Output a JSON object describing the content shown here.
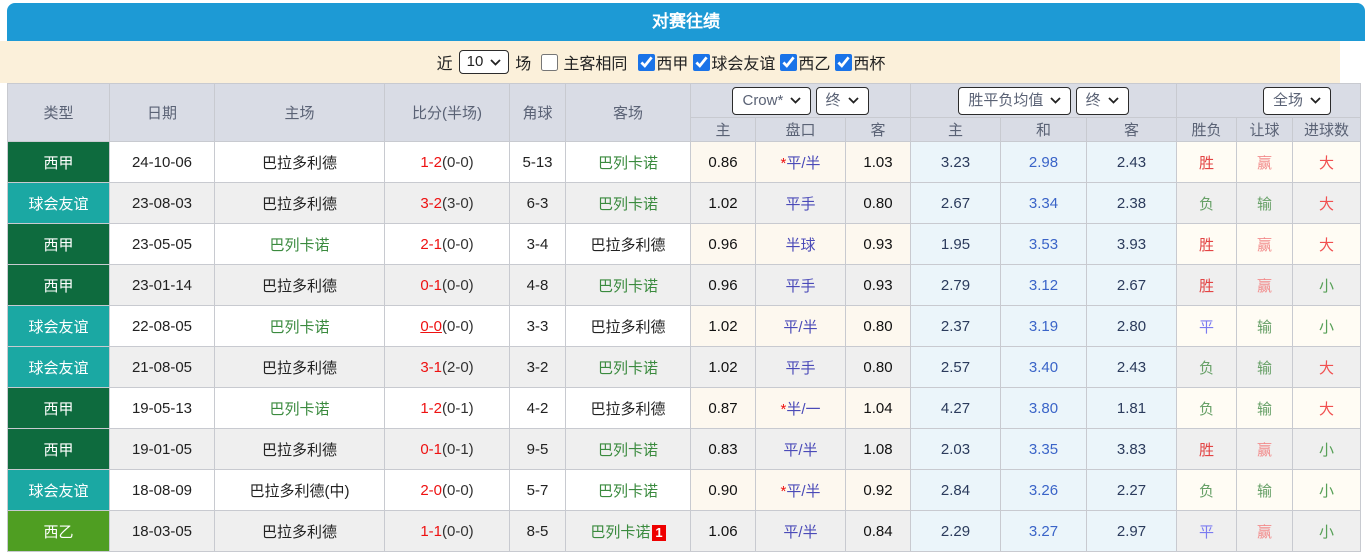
{
  "title": "对赛往绩",
  "colors": {
    "title_bar_blue": "#1d9ad5",
    "filter_bar_cream": "#fbf0da",
    "header_gray": "#d9dce5",
    "laliga_green": "#0e6b3e",
    "friendly_teal": "#1ba8a3",
    "segunda_green": "#4f9e22",
    "score_red": "#ee1111",
    "team_green": "#3a8a3e",
    "handicap_blue": "#4a4ab8",
    "avg_draw_blue": "#3a64c8",
    "avg_col_bg": "#ebf5fa",
    "win_red": "#e34444",
    "lose_green": "#67a067",
    "draw_blue": "#7b7bf0",
    "big_red": "#f15050",
    "small_green": "#57a057",
    "badge_red": "#ee0000",
    "checkbox_blue": "#1a73e8"
  },
  "filter": {
    "near_label": "近",
    "count_value": "10",
    "games_label": "场",
    "same_venue_label": "主客相同",
    "same_venue_checked": false,
    "leagues": [
      {
        "label": "西甲",
        "checked": true
      },
      {
        "label": "球会友谊",
        "checked": true
      },
      {
        "label": "西乙",
        "checked": true
      },
      {
        "label": "西杯",
        "checked": true
      }
    ]
  },
  "table": {
    "columns": [
      "类型",
      "日期",
      "主场",
      "比分(半场)",
      "角球",
      "客场"
    ],
    "odds_group": {
      "provider_select": "Crow*",
      "time_select": "终",
      "sub": [
        "主",
        "盘口",
        "客"
      ]
    },
    "avg_group": {
      "type_select": "胜平负均值",
      "time_select": "终",
      "sub": [
        "主",
        "和",
        "客"
      ]
    },
    "result_group": {
      "scope_select": "全场",
      "sub": [
        "胜负",
        "让球",
        "进球数"
      ]
    },
    "green_team": "巴列卡诺",
    "rows": [
      {
        "type": "西甲",
        "date": "24-10-06",
        "home": "巴拉多利德",
        "score": "1-2",
        "half": "(0-0)",
        "corner": "5-13",
        "away": "巴列卡诺",
        "odds": {
          "home": "0.86",
          "star": true,
          "handicap": "平/半",
          "away": "1.03"
        },
        "avg": {
          "home": "3.23",
          "draw": "2.98",
          "away": "2.43"
        },
        "result": {
          "outcome": "胜",
          "handicap": "赢",
          "goals": "大"
        }
      },
      {
        "type": "球会友谊",
        "date": "23-08-03",
        "home": "巴拉多利德",
        "score": "3-2",
        "half": "(3-0)",
        "corner": "6-3",
        "away": "巴列卡诺",
        "odds": {
          "home": "1.02",
          "star": false,
          "handicap": "平手",
          "away": "0.80"
        },
        "avg": {
          "home": "2.67",
          "draw": "3.34",
          "away": "2.38"
        },
        "result": {
          "outcome": "负",
          "handicap": "输",
          "goals": "大"
        }
      },
      {
        "type": "西甲",
        "date": "23-05-05",
        "home": "巴列卡诺",
        "score": "2-1",
        "half": "(0-0)",
        "corner": "3-4",
        "away": "巴拉多利德",
        "odds": {
          "home": "0.96",
          "star": false,
          "handicap": "半球",
          "away": "0.93"
        },
        "avg": {
          "home": "1.95",
          "draw": "3.53",
          "away": "3.93"
        },
        "result": {
          "outcome": "胜",
          "handicap": "赢",
          "goals": "大"
        }
      },
      {
        "type": "西甲",
        "date": "23-01-14",
        "home": "巴拉多利德",
        "score": "0-1",
        "half": "(0-0)",
        "corner": "4-8",
        "away": "巴列卡诺",
        "odds": {
          "home": "0.96",
          "star": false,
          "handicap": "平手",
          "away": "0.93"
        },
        "avg": {
          "home": "2.79",
          "draw": "3.12",
          "away": "2.67"
        },
        "result": {
          "outcome": "胜",
          "handicap": "赢",
          "goals": "小"
        }
      },
      {
        "type": "球会友谊",
        "date": "22-08-05",
        "home": "巴列卡诺",
        "score": "0-0",
        "score_underline": true,
        "half": "(0-0)",
        "corner": "3-3",
        "away": "巴拉多利德",
        "odds": {
          "home": "1.02",
          "star": false,
          "handicap": "平/半",
          "away": "0.80"
        },
        "avg": {
          "home": "2.37",
          "draw": "3.19",
          "away": "2.80"
        },
        "result": {
          "outcome": "平",
          "handicap": "输",
          "goals": "小"
        }
      },
      {
        "type": "球会友谊",
        "date": "21-08-05",
        "home": "巴拉多利德",
        "score": "3-1",
        "half": "(2-0)",
        "corner": "3-2",
        "away": "巴列卡诺",
        "odds": {
          "home": "1.02",
          "star": false,
          "handicap": "平手",
          "away": "0.80"
        },
        "avg": {
          "home": "2.57",
          "draw": "3.40",
          "away": "2.43"
        },
        "result": {
          "outcome": "负",
          "handicap": "输",
          "goals": "大"
        }
      },
      {
        "type": "西甲",
        "date": "19-05-13",
        "home": "巴列卡诺",
        "score": "1-2",
        "half": "(0-1)",
        "corner": "4-2",
        "away": "巴拉多利德",
        "odds": {
          "home": "0.87",
          "star": true,
          "handicap": "半/一",
          "away": "1.04"
        },
        "avg": {
          "home": "4.27",
          "draw": "3.80",
          "away": "1.81"
        },
        "result": {
          "outcome": "负",
          "handicap": "输",
          "goals": "大"
        }
      },
      {
        "type": "西甲",
        "date": "19-01-05",
        "home": "巴拉多利德",
        "score": "0-1",
        "half": "(0-1)",
        "corner": "9-5",
        "away": "巴列卡诺",
        "odds": {
          "home": "0.83",
          "star": false,
          "handicap": "平/半",
          "away": "1.08"
        },
        "avg": {
          "home": "2.03",
          "draw": "3.35",
          "away": "3.83"
        },
        "result": {
          "outcome": "胜",
          "handicap": "赢",
          "goals": "小"
        }
      },
      {
        "type": "球会友谊",
        "date": "18-08-09",
        "home": "巴拉多利德(中)",
        "score": "2-0",
        "half": "(0-0)",
        "corner": "5-7",
        "away": "巴列卡诺",
        "odds": {
          "home": "0.90",
          "star": true,
          "handicap": "平/半",
          "away": "0.92"
        },
        "avg": {
          "home": "2.84",
          "draw": "3.26",
          "away": "2.27"
        },
        "result": {
          "outcome": "负",
          "handicap": "输",
          "goals": "小"
        }
      },
      {
        "type": "西乙",
        "date": "18-03-05",
        "home": "巴拉多利德",
        "score": "1-1",
        "half": "(0-0)",
        "corner": "8-5",
        "away": "巴列卡诺",
        "away_badge": "1",
        "odds": {
          "home": "1.06",
          "star": false,
          "handicap": "平/半",
          "away": "0.84"
        },
        "avg": {
          "home": "2.29",
          "draw": "3.27",
          "away": "2.97"
        },
        "result": {
          "outcome": "平",
          "handicap": "赢",
          "goals": "小"
        }
      }
    ]
  }
}
